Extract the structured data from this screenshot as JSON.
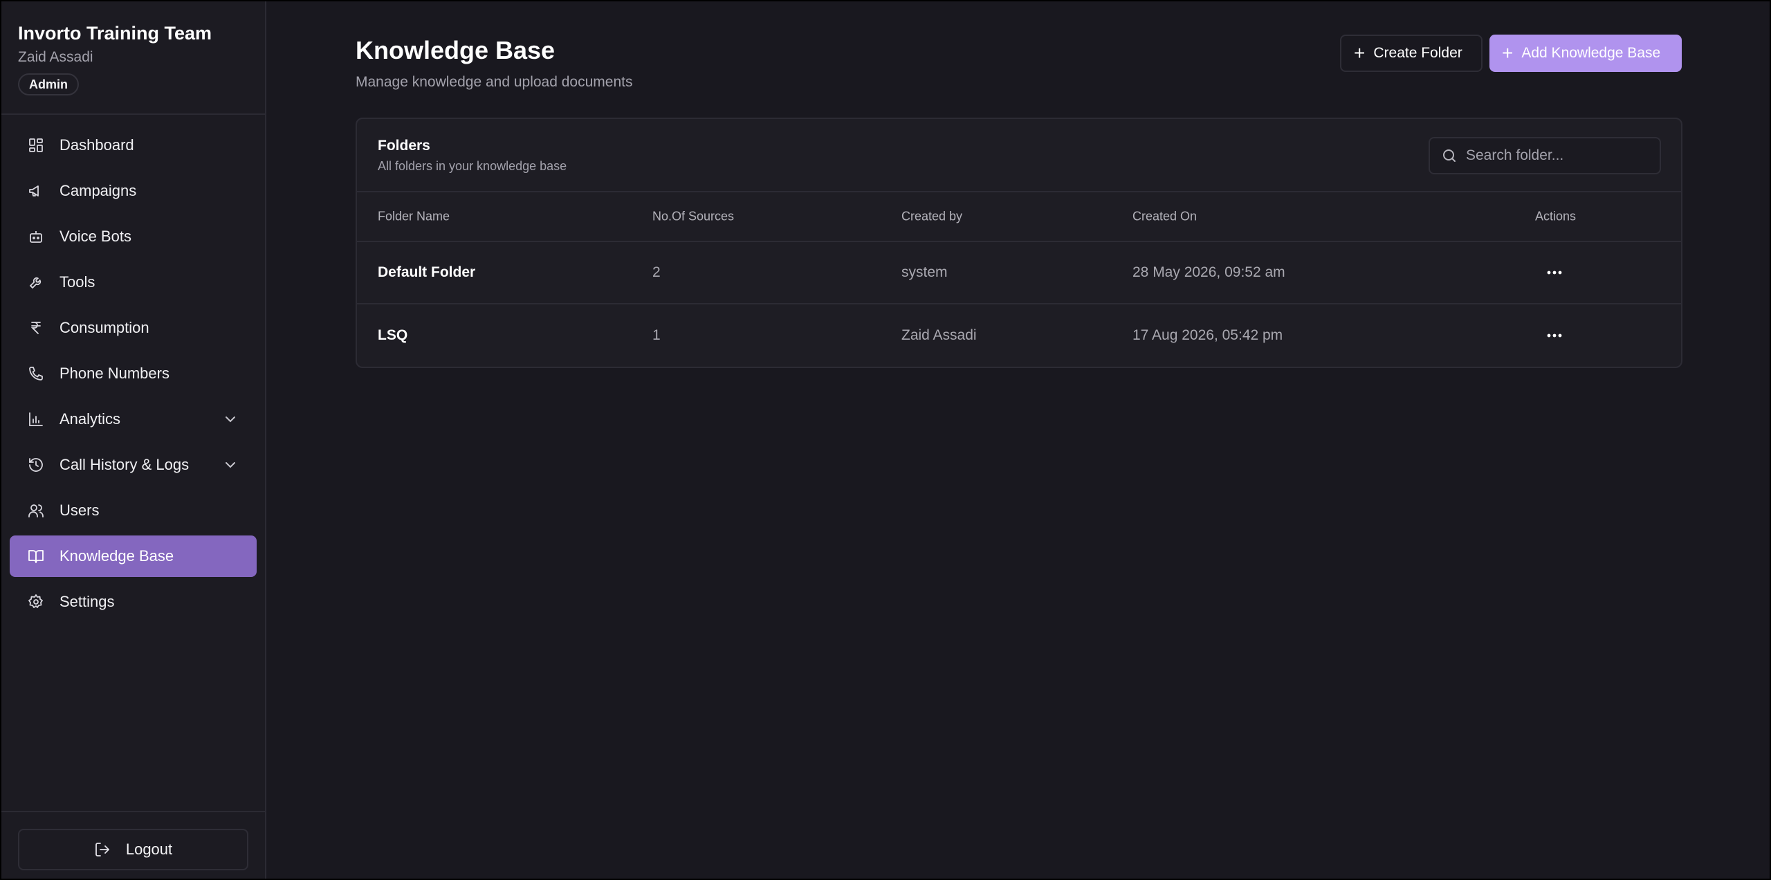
{
  "sidebar": {
    "org_name": "Invorto Training Team",
    "user_name": "Zaid Assadi",
    "role_badge": "Admin",
    "items": [
      {
        "label": "Dashboard",
        "icon": "dashboard-icon"
      },
      {
        "label": "Campaigns",
        "icon": "megaphone-icon"
      },
      {
        "label": "Voice Bots",
        "icon": "bot-icon"
      },
      {
        "label": "Tools",
        "icon": "wrench-icon"
      },
      {
        "label": "Consumption",
        "icon": "rupee-icon"
      },
      {
        "label": "Phone Numbers",
        "icon": "phone-icon"
      },
      {
        "label": "Analytics",
        "icon": "bar-chart-icon",
        "expandable": true
      },
      {
        "label": "Call History & Logs",
        "icon": "history-icon",
        "expandable": true
      },
      {
        "label": "Users",
        "icon": "users-icon"
      },
      {
        "label": "Knowledge Base",
        "icon": "book-icon",
        "active": true
      },
      {
        "label": "Settings",
        "icon": "gear-icon"
      }
    ],
    "logout_label": "Logout"
  },
  "header": {
    "title": "Knowledge Base",
    "subtitle": "Manage knowledge and upload documents",
    "create_folder_label": "Create Folder",
    "add_kb_label": "Add Knowledge Base"
  },
  "folders": {
    "title": "Folders",
    "subtitle": "All folders in your knowledge base",
    "search_placeholder": "Search folder...",
    "columns": [
      "Folder Name",
      "No.Of Sources",
      "Created by",
      "Created On",
      "Actions"
    ],
    "rows": [
      {
        "name": "Default Folder",
        "sources": "2",
        "created_by": "system",
        "created_on": "28 May 2026, 09:52 am"
      },
      {
        "name": "LSQ",
        "sources": "1",
        "created_by": "Zaid Assadi",
        "created_on": "17 Aug 2026, 05:42 pm"
      }
    ]
  },
  "colors": {
    "accent": "#b093ee",
    "active_nav": "#8467bf",
    "background": "#19181f"
  }
}
